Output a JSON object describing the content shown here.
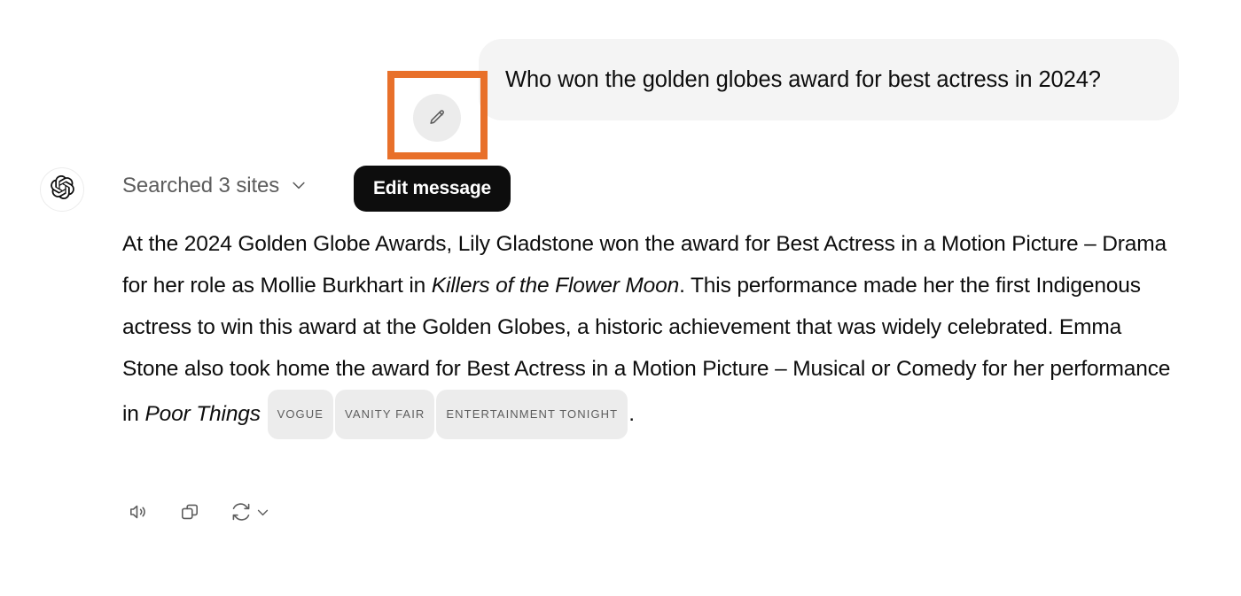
{
  "colors": {
    "highlight": "#e8702a",
    "bubble_bg": "#f4f4f4",
    "tooltip_bg": "#0d0d0d",
    "cite_bg": "#ececec",
    "text": "#0d0d0d",
    "muted_text": "#5d5d5d"
  },
  "user_turn": {
    "message": "Who won the golden globes award for best actress in 2024?",
    "edit_button_icon": "pencil-icon",
    "tooltip": "Edit message"
  },
  "assistant_turn": {
    "avatar_icon": "openai-logo-icon",
    "search_status": {
      "label": "Searched 3 sites",
      "chevron_icon": "chevron-down-icon"
    },
    "answer": {
      "segments": [
        {
          "type": "text",
          "value": "At the 2024 Golden Globe Awards, Lily Gladstone won the award for Best Actress in a Motion Picture – Drama for her role as Mollie Burkhart in "
        },
        {
          "type": "italic",
          "value": "Killers of the Flower Moon"
        },
        {
          "type": "text",
          "value": ". This performance made her the first Indigenous actress to win this award at the Golden Globes, a historic achievement that was widely celebrated. Emma Stone also took home the award for Best Actress in a Motion Picture – Musical or Comedy for her performance in "
        },
        {
          "type": "italic",
          "value": "Poor Things"
        },
        {
          "type": "text",
          "value": " "
        },
        {
          "type": "citation",
          "value": "VOGUE"
        },
        {
          "type": "citation",
          "value": "VANITY FAIR"
        },
        {
          "type": "citation",
          "value": "ENTERTAINMENT TONIGHT"
        },
        {
          "type": "text",
          "value": "."
        }
      ],
      "part1": "At the 2024 Golden Globe Awards, Lily Gladstone won the award for Best Actress in a Motion Picture – Drama for her role as Mollie Burkhart in ",
      "title1": "Killers of the Flower Moon",
      "part2": ". This performance made her the first Indigenous actress to win this award at the Golden Globes, a historic achievement that was widely celebrated. Emma Stone also took home the award for Best Actress in a Motion Picture – Musical or Comedy for her performance in ",
      "title2": "Poor Things",
      "part3": ".",
      "citations": [
        "VOGUE",
        "VANITY FAIR",
        "ENTERTAINMENT TONIGHT"
      ]
    },
    "actions": [
      {
        "name": "read-aloud-button",
        "icon": "speaker-icon"
      },
      {
        "name": "copy-button",
        "icon": "copy-icon"
      },
      {
        "name": "regenerate-button",
        "icon": "refresh-icon"
      }
    ]
  }
}
